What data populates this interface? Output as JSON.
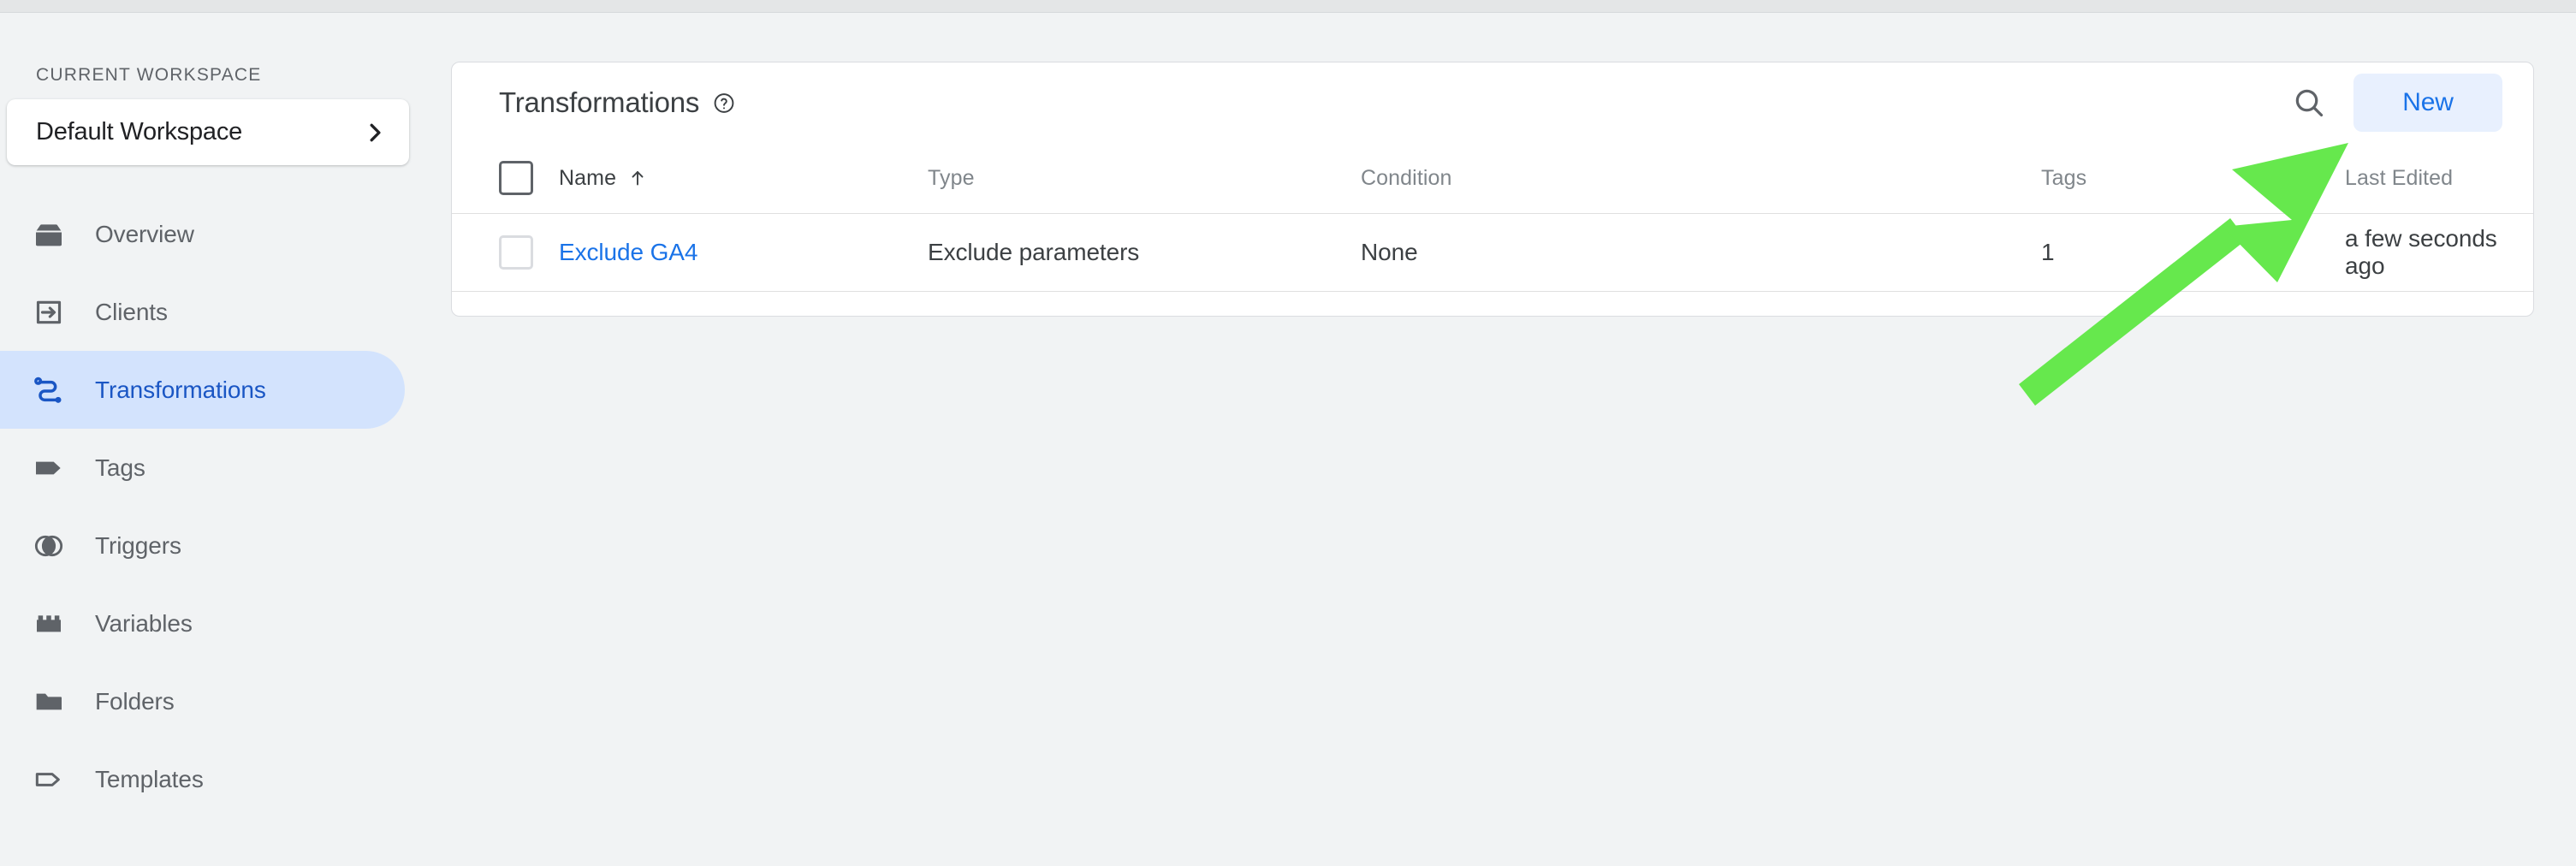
{
  "sidebar": {
    "workspace_section_label": "CURRENT WORKSPACE",
    "workspace_name": "Default Workspace",
    "workspace_chevron_icon": "chevron-right-icon",
    "items": [
      {
        "label": "Overview",
        "icon": "overview-box-icon",
        "active": false
      },
      {
        "label": "Clients",
        "icon": "clients-arrow-in-icon",
        "active": false
      },
      {
        "label": "Transformations",
        "icon": "transformations-path-icon",
        "active": true
      },
      {
        "label": "Tags",
        "icon": "tag-filled-icon",
        "active": false
      },
      {
        "label": "Triggers",
        "icon": "triggers-circles-icon",
        "active": false
      },
      {
        "label": "Variables",
        "icon": "variables-block-icon",
        "active": false
      },
      {
        "label": "Folders",
        "icon": "folder-filled-icon",
        "active": false
      },
      {
        "label": "Templates",
        "icon": "template-outline-icon",
        "active": false
      }
    ]
  },
  "card": {
    "title": "Transformations",
    "help_icon": "help-circle-icon",
    "search_icon": "search-icon",
    "new_button_label": "New",
    "table": {
      "select_all_checkbox": "select-all-checkbox",
      "columns": [
        {
          "key": "name",
          "label": "Name",
          "sorted": true,
          "sort_direction": "ascending"
        },
        {
          "key": "type",
          "label": "Type",
          "sorted": false,
          "sort_direction": ""
        },
        {
          "key": "condition",
          "label": "Condition",
          "sorted": false,
          "sort_direction": ""
        },
        {
          "key": "tags",
          "label": "Tags",
          "sorted": false,
          "sort_direction": ""
        },
        {
          "key": "edited",
          "label": "Last Edited",
          "sorted": false,
          "sort_direction": ""
        }
      ],
      "rows": [
        {
          "name": "Exclude GA4",
          "type": "Exclude parameters",
          "condition": "None",
          "tags": "1",
          "edited": "a few seconds ago"
        }
      ]
    }
  },
  "annotation": {
    "arrow_icon": "green-pointer-arrow",
    "color": "#66E84D",
    "points_at": "New"
  },
  "colors": {
    "page_background": "#F1F3F4",
    "card_background": "#FFFFFF",
    "accent_blue": "#1A73E8",
    "active_nav_background": "#D3E3FD",
    "active_nav_text": "#1A56C4",
    "new_button_background": "#E8F0FE",
    "muted_text": "#80868B",
    "body_text": "#3C4043",
    "annotation_green": "#66E84D"
  }
}
